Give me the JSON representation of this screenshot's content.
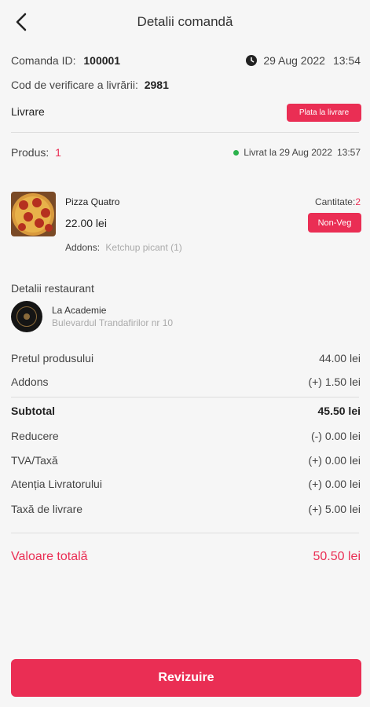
{
  "header": {
    "title": "Detalii comandă"
  },
  "order": {
    "id_label": "Comanda ID:",
    "id_value": "100001",
    "date": "29 Aug 2022",
    "time": "13:54",
    "verify_label": "Cod de verificare a livrării:",
    "verify_code": "2981",
    "type_label": "Livrare",
    "payment_badge": "Plata la livrare"
  },
  "product_summary": {
    "label": "Produs:",
    "count": "1",
    "status": "Livrat la 29 Aug 2022",
    "status_time": "13:57",
    "status_color": "#2bb24c"
  },
  "item": {
    "name": "Pizza Quatro",
    "price": "22.00 lei",
    "qty_label": "Cantitate:",
    "qty_value": "2",
    "tag": "Non-Veg",
    "addons_label": "Addons:",
    "addons_value": "Ketchup picant (1)"
  },
  "restaurant": {
    "section_title": "Detalii restaurant",
    "name": "La Academie",
    "address": "Bulevardul Trandafirilor nr 10"
  },
  "pricing": [
    {
      "label": "Pretul produsului",
      "value": "44.00 lei"
    },
    {
      "label": "Addons",
      "value": "(+) 1.50 lei"
    }
  ],
  "subtotal": {
    "label": "Subtotal",
    "value": "45.50 lei"
  },
  "charges": [
    {
      "label": "Reducere",
      "value": "(-) 0.00 lei"
    },
    {
      "label": "TVA/Taxă",
      "value": "(+) 0.00 lei"
    },
    {
      "label": "Atenția Livratorului",
      "value": "(+) 0.00 lei"
    },
    {
      "label": "Taxă de livrare",
      "value": "(+) 5.00 lei"
    }
  ],
  "total": {
    "label": "Valoare totală",
    "value": "50.50 lei"
  },
  "actions": {
    "review": "Revizuire"
  },
  "colors": {
    "accent": "#ea2e54"
  }
}
